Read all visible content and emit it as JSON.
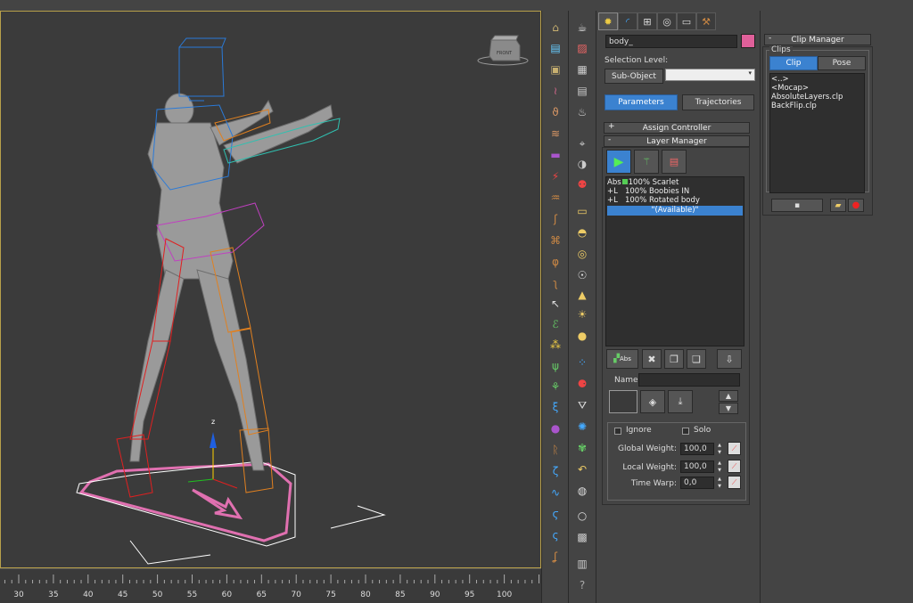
{
  "timeline": {
    "ticks": [
      "30",
      "35",
      "40",
      "45",
      "50",
      "55",
      "60",
      "65",
      "70",
      "75",
      "80",
      "85",
      "90",
      "95",
      "100"
    ]
  },
  "viewport": {
    "gizmo_axis_label": "z",
    "viewcube_label": "FRONT"
  },
  "command_panel": {
    "object_name": "body_",
    "object_color": "#e0609a",
    "selection_level_label": "Selection Level:",
    "sub_object_label": "Sub-Object",
    "sub_object_value": "",
    "parameters_label": "Parameters",
    "trajectories_label": "Trajectories",
    "assign_controller": {
      "sign": "+",
      "label": "Assign Controller"
    },
    "layer_manager": {
      "sign": "-",
      "label": "Layer Manager"
    },
    "layers": [
      {
        "flag": "Abs",
        "weight": "100%",
        "name": "Scarlet"
      },
      {
        "flag": "+L",
        "weight": "100%",
        "name": "Boobies IN"
      },
      {
        "flag": "+L",
        "weight": "100%",
        "name": "Rotated body"
      }
    ],
    "available_label": "\"(Available)\"",
    "abs_button_label": "Abs",
    "name_label": "Name:",
    "name_value": "",
    "ignore_label": "Ignore",
    "solo_label": "Solo",
    "global_weight_label": "Global Weight:",
    "global_weight_value": "100,0",
    "local_weight_label": "Local Weight:",
    "local_weight_value": "100,0",
    "time_warp_label": "Time Warp:",
    "time_warp_value": "0,0"
  },
  "clip_manager": {
    "title": "Clip Manager",
    "sign": "-",
    "clips_group": "Clips",
    "tab_clip": "Clip",
    "tab_pose": "Pose",
    "clips": [
      "<..>",
      "<Mocap>",
      "AbsoluteLayers.clp",
      "BackFlip.clp"
    ]
  }
}
